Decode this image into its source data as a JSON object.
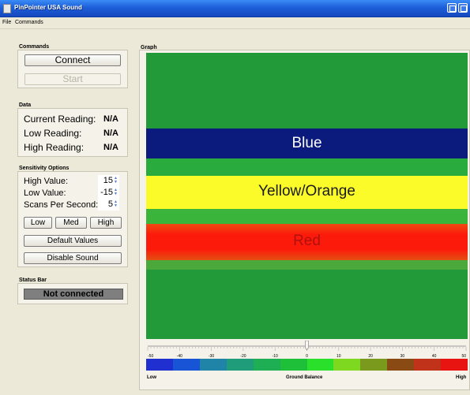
{
  "window": {
    "title": "PinPointer USA Sound"
  },
  "menu": {
    "file": "File",
    "commands": "Commands"
  },
  "commands": {
    "title": "Commands",
    "connect_label": "Connect",
    "start_label": "Start"
  },
  "data_group": {
    "title": "Data",
    "current_label": "Current Reading:",
    "current_value": "N/A",
    "low_label": "Low Reading:",
    "low_value": "N/A",
    "high_label": "High Reading:",
    "high_value": "N/A"
  },
  "sensitivity": {
    "title": "Sensitivity Options",
    "high_label": "High Value:",
    "high_value": "15",
    "low_label": "Low Value:",
    "low_value": "-15",
    "scans_label": "Scans Per Second:",
    "scans_value": "5",
    "preset_low": "Low",
    "preset_med": "Med",
    "preset_high": "High",
    "default_label": "Default Values",
    "disable_sound_label": "Disable Sound"
  },
  "status": {
    "title": "Status Bar",
    "text": "Not connected"
  },
  "graph": {
    "title": "Graph",
    "bands": {
      "blue": "Blue",
      "yellow": "Yellow/Orange",
      "red": "Red"
    },
    "colors": {
      "background": "#229a3a",
      "blue": "#0a1b7d",
      "yellow": "#fbfb2a",
      "red": "#fc1a0a"
    },
    "scale": {
      "ticks": [
        "-50",
        "-40",
        "-30",
        "-20",
        "-10",
        "0",
        "10",
        "20",
        "30",
        "40",
        "50"
      ],
      "low_label": "Low",
      "center_label": "Ground Balance",
      "high_label": "High",
      "slider_value": 0,
      "colors": [
        "#1f2fd0",
        "#1855d6",
        "#1f84a8",
        "#1f9c7a",
        "#1eae53",
        "#1ec03a",
        "#2be02a",
        "#7ed81f",
        "#7a9a1e",
        "#8a4a14",
        "#c0321a",
        "#e81412"
      ]
    }
  }
}
